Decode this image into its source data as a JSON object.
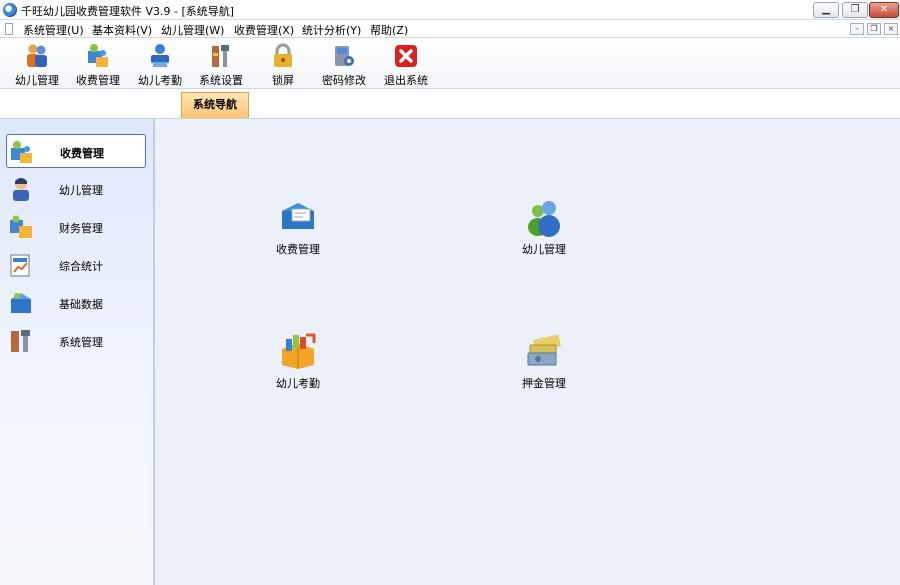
{
  "window": {
    "title": "千旺幼儿园收费管理软件 V3.9 - [系统导航]",
    "controls": {
      "minimize": "▁",
      "restore": "❐",
      "close": "✕"
    }
  },
  "menubar": {
    "items": [
      {
        "label": "系统管理(U)"
      },
      {
        "label": "基本资料(V)"
      },
      {
        "label": "幼儿管理(W)"
      },
      {
        "label": "收费管理(X)"
      },
      {
        "label": "统计分析(Y)"
      },
      {
        "label": "帮助(Z)"
      }
    ],
    "mdi_controls": {
      "minimize": "–",
      "restore": "❐",
      "close": "×"
    }
  },
  "toolbar": {
    "items": [
      {
        "label": "幼儿管理",
        "icon": "children-icon"
      },
      {
        "label": "收费管理",
        "icon": "fee-icon"
      },
      {
        "label": "幼儿考勤",
        "icon": "attendance-icon"
      },
      {
        "label": "系统设置",
        "icon": "settings-icon"
      },
      {
        "label": "锁屏",
        "icon": "lock-icon"
      },
      {
        "label": "密码修改",
        "icon": "password-icon"
      },
      {
        "label": "退出系统",
        "icon": "exit-icon"
      }
    ]
  },
  "tabs": {
    "active": "系统导航"
  },
  "sidebar": {
    "items": [
      {
        "label": "收费管理",
        "icon": "fee-icon",
        "active": true
      },
      {
        "label": "幼儿管理",
        "icon": "child-icon",
        "active": false
      },
      {
        "label": "财务管理",
        "icon": "finance-icon",
        "active": false
      },
      {
        "label": "综合统计",
        "icon": "statistics-icon",
        "active": false
      },
      {
        "label": "基础数据",
        "icon": "basic-data-icon",
        "active": false
      },
      {
        "label": "系统管理",
        "icon": "system-icon",
        "active": false
      }
    ]
  },
  "main": {
    "tiles": [
      {
        "label": "收费管理",
        "icon": "fee-mailbox-icon"
      },
      {
        "label": "幼儿管理",
        "icon": "users-icon"
      },
      {
        "label": "幼儿考勤",
        "icon": "attendance-box-icon"
      },
      {
        "label": "押金管理",
        "icon": "deposit-icon"
      }
    ]
  }
}
